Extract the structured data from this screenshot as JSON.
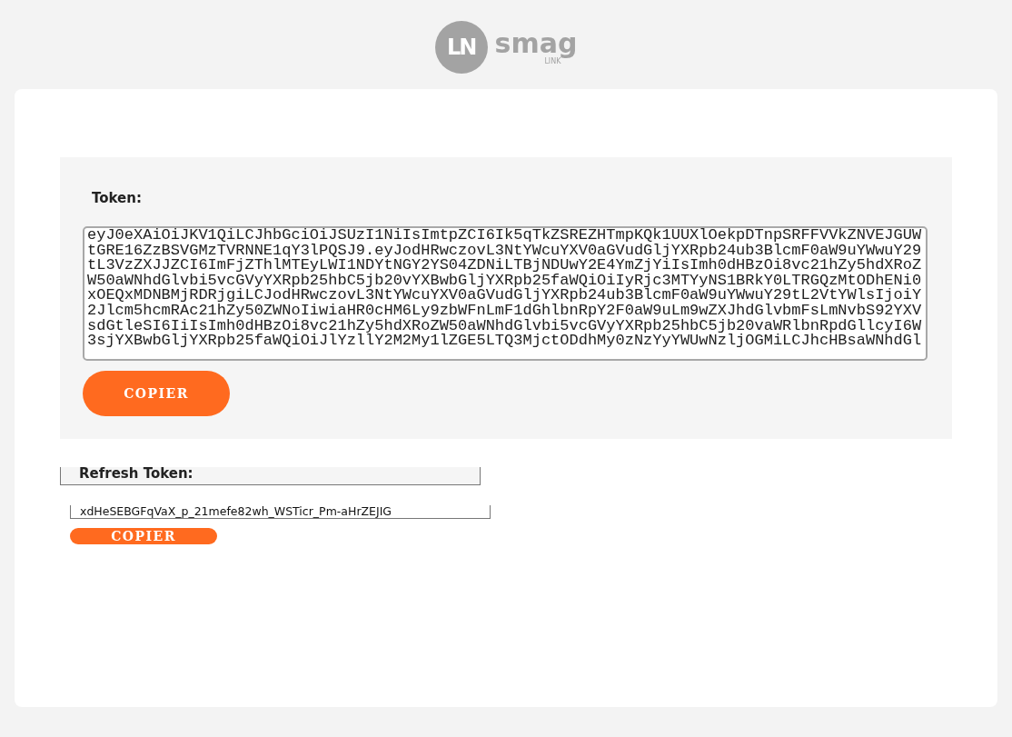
{
  "logo": {
    "mark": "LN",
    "name": "smag",
    "sub": "LINK"
  },
  "sections": [
    {
      "label": "Token:",
      "kind": "textarea",
      "value": "eyJ0eXAiOiJKV1QiLCJhbGciOiJSUzI1NiIsImtpZCI6Ik5qTkZSREZHTmpKQk1UUXlOekpDTnpSRFFVVkZNVEJGUWtGRE16ZzBSVGMzTVRNNE1qY3lPQSJ9.eyJodHRwczovL3NtYWcuYXV0aGVudGljYXRpb24ub3BlcmF0aW9uYWwuY29tL3VzZXJJZCI6ImFjZThlMTEyLWI1NDYtNGY2YS04ZDNiLTBjNDUwY2E4YmZjYiIsImh0dHBzOi8vc21hZy5hdXRoZW50aWNhdGlvbi5vcGVyYXRpb25hbC5jb20vYXBwbGljYXRpb25faWQiOiIyRjc3MTYyNS1BRkY0LTRGQzMtODhENi0xOEQxMDNBMjRDRjgiLCJodHRwczovL3NtYWcuYXV0aGVudGljYXRpb24ub3BlcmF0aW9uYWwuY29tL2VtYWlsIjoiY2Jlcm5hcmRAc21hZy50ZWNoIiwiaHR0cHM6Ly9zbWFnLmF1dGhlbnRpY2F0aW9uLm9wZXJhdGlvbmFsLmNvbS92YXVsdGtleSI6IiIsImh0dHBzOi8vc21hZy5hdXRoZW50aWNhdGlvbi5vcGVyYXRpb25hbC5jb20vaWRlbnRpdGllcyI6W3sjYXBwbGljYXRpb25faWQiOiJlYzllY2M2My1lZGE5LTQ3MjctODdhMy0zNzYyYWUwNzljOGMiLCJhcHBsaWNhdGl",
      "button": "COPIER"
    },
    {
      "label": "Refresh Token:",
      "kind": "line",
      "value": "xdHeSEBGFqVaX_p_21mefe82wh_WSTicr_Pm-aHrZEJIG",
      "button": "COPIER"
    }
  ]
}
